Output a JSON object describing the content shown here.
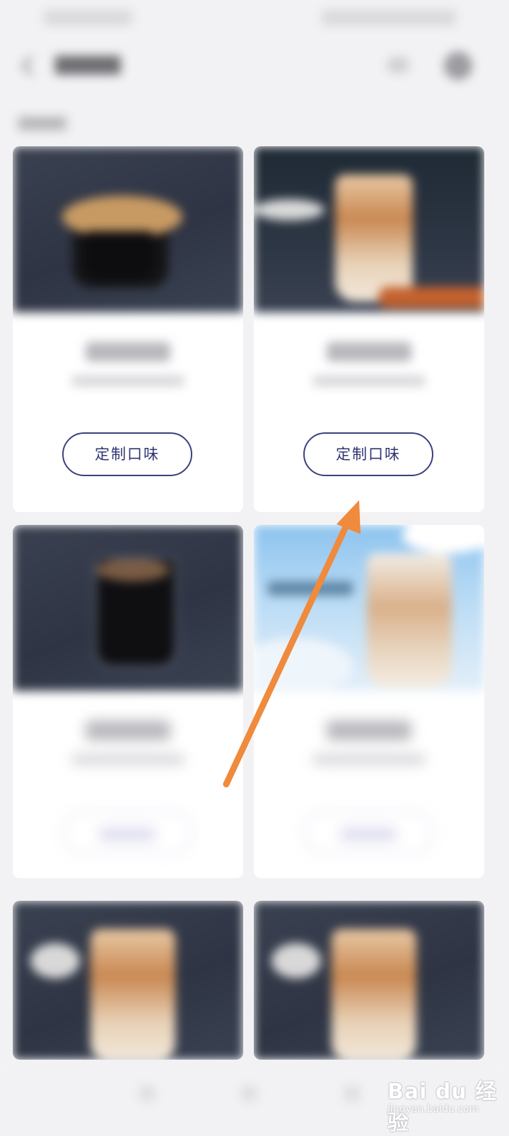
{
  "cards": [
    {
      "button_label": "定制口味"
    },
    {
      "button_label": "定制口味"
    }
  ],
  "watermark": {
    "logo": "Bai du 经验",
    "url": "jingyan.baidu.com"
  },
  "colors": {
    "accent": "#2f3470",
    "arrow": "#f08a3c",
    "background": "#f2f2f4",
    "card": "#ffffff"
  }
}
